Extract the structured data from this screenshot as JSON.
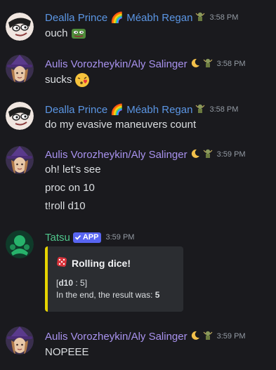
{
  "colors": {
    "background": "#1a1a1e",
    "name_blue": "#5b96e4",
    "name_purple": "#a892ee",
    "name_green": "#4fc58b",
    "timestamp": "#949ba4",
    "app_badge": "#5865f2",
    "embed_accent": "#e6d400"
  },
  "messages": [
    {
      "author": "Dealla Prince 🌈 Méabh Regan",
      "role_icon": "troll-icon",
      "timestamp": "3:58 PM",
      "lines": [
        "ouch"
      ],
      "emoji": "pepe-emoji"
    },
    {
      "author": "Aulis Vorozheykin/Aly Salinger",
      "badge_icons": [
        "crescent-moon-icon",
        "troll-icon"
      ],
      "timestamp": "3:58 PM",
      "lines": [
        "sucks"
      ],
      "emoji": "kissing-heart-emoji"
    },
    {
      "author": "Dealla Prince 🌈 Méabh Regan",
      "role_icon": "troll-icon",
      "timestamp": "3:58 PM",
      "lines": [
        "do my evasive maneuvers count"
      ]
    },
    {
      "author": "Aulis Vorozheykin/Aly Salinger",
      "badge_icons": [
        "crescent-moon-icon",
        "troll-icon"
      ],
      "timestamp": "3:59 PM",
      "lines": [
        "oh! let's see",
        "proc on 10",
        "t!roll d10"
      ]
    },
    {
      "author": "Tatsu",
      "app_tag": "APP",
      "timestamp": "3:59 PM",
      "embed": {
        "title": "Rolling dice!",
        "title_icon": "dice-icon",
        "dice_label": "d10",
        "dice_sep": " : ",
        "dice_value": "5",
        "result_prefix": "In the end, the result was: ",
        "result_value": "5"
      }
    },
    {
      "author": "Aulis Vorozheykin/Aly Salinger",
      "badge_icons": [
        "crescent-moon-icon",
        "troll-icon"
      ],
      "timestamp": "3:59 PM",
      "lines": [
        "NOPEEE"
      ]
    }
  ]
}
